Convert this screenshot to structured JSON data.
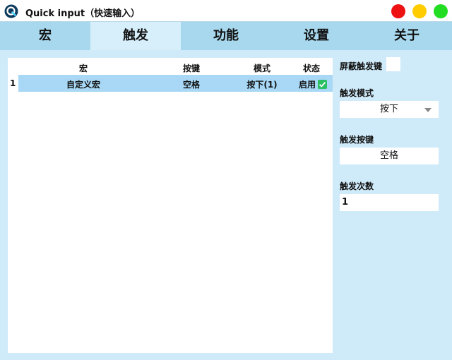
{
  "window": {
    "title": "Quick input（快速输入）"
  },
  "tabs": [
    {
      "label": "宏"
    },
    {
      "label": "触发"
    },
    {
      "label": "功能"
    },
    {
      "label": "设置"
    },
    {
      "label": "关于"
    }
  ],
  "active_tab": "触发",
  "table": {
    "headers": {
      "macro": "宏",
      "key": "按键",
      "mode": "模式",
      "status": "状态"
    },
    "rows": [
      {
        "index": "1",
        "macro": "自定义宏",
        "key": "空格",
        "mode": "按下(1)",
        "status": "启用",
        "enabled": true
      }
    ]
  },
  "side": {
    "block_trigger_label": "屏蔽触发键",
    "block_trigger_checked": false,
    "trigger_mode_label": "触发模式",
    "trigger_mode_value": "按下",
    "trigger_key_label": "触发按键",
    "trigger_key_value": "空格",
    "trigger_count_label": "触发次数",
    "trigger_count_value": "1"
  },
  "colors": {
    "background": "#cfeaf9",
    "tab_bar": "#a7d8ed",
    "tab_active": "#d6effb",
    "row_selected": "#a8d8f5",
    "status_check": "#2bbf63",
    "close": "#ee1111",
    "minimize": "#ffcc00",
    "maximize": "#22dd22"
  }
}
